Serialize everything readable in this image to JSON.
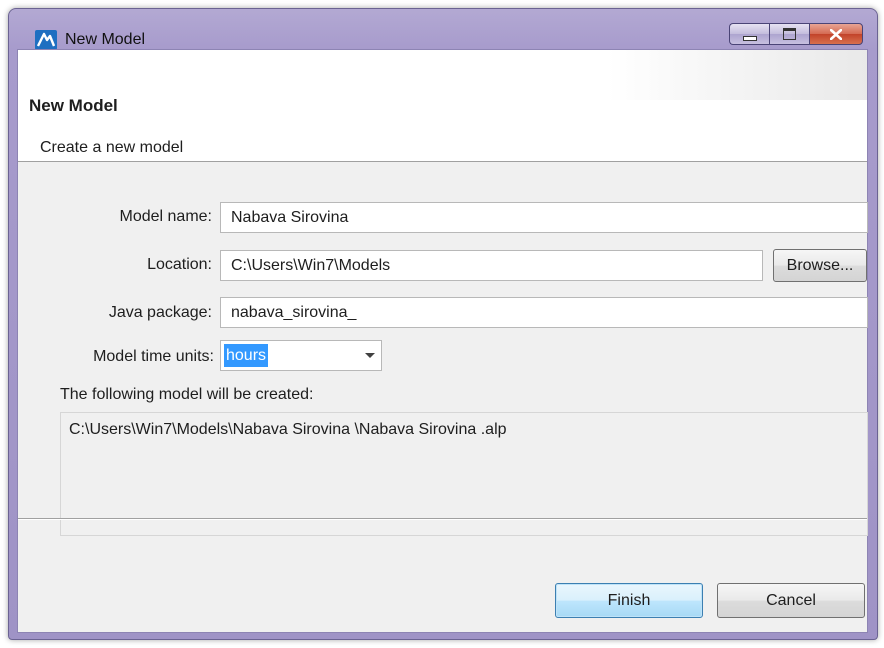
{
  "window": {
    "title": "New Model"
  },
  "header": {
    "title": "New Model",
    "subtitle": "Create a new model"
  },
  "form": {
    "model_name_label": "Model name:",
    "model_name_value": "Nabava Sirovina",
    "location_label": "Location:",
    "location_value": "C:\\Users\\Win7\\Models",
    "browse_label": "Browse...",
    "java_package_label": "Java package:",
    "java_package_value": "nabava_sirovina_",
    "time_units_label": "Model time units:",
    "time_units_value": "hours",
    "created_label": "The following model will be created:",
    "created_path": "C:\\Users\\Win7\\Models\\Nabava Sirovina \\Nabava Sirovina .alp"
  },
  "buttons": {
    "finish": "Finish",
    "cancel": "Cancel"
  },
  "colors": {
    "title_bar": "#a79bcc",
    "close_button": "#c2432a",
    "selection": "#3399ff",
    "default_button_border": "#3c7fb1"
  },
  "icons": {
    "app": "anylogic-logo-icon",
    "minimize": "minimize-icon",
    "maximize": "maximize-icon",
    "close": "close-icon",
    "dropdown": "chevron-down-icon"
  }
}
